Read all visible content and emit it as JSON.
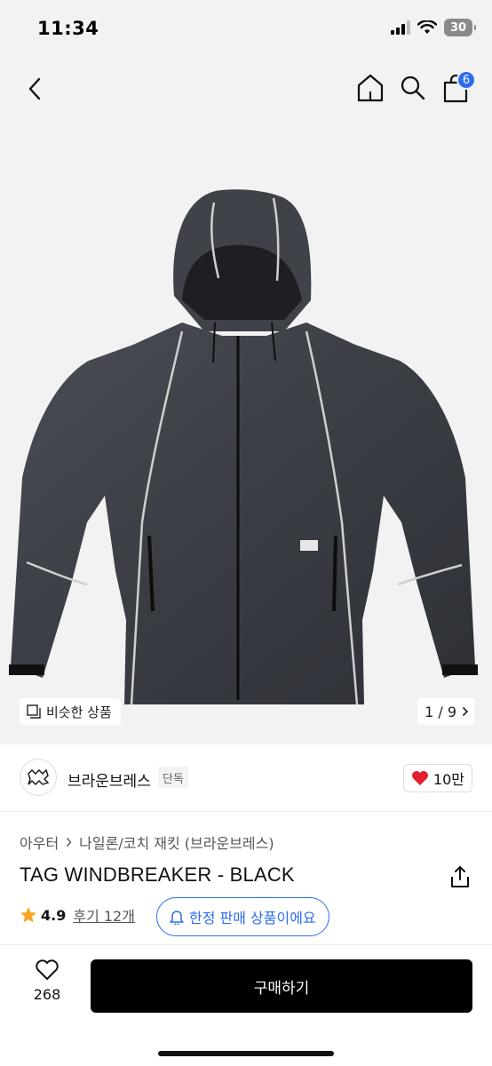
{
  "status_bar": {
    "time": "11:34",
    "battery": "30"
  },
  "top_nav": {
    "cart_count": "6"
  },
  "gallery": {
    "similar_label": "비슷한 상품",
    "page_indicator": "1 / 9"
  },
  "brand": {
    "name": "브라운브레스",
    "tag": "단독",
    "likes": "10만"
  },
  "product": {
    "breadcrumb": [
      "아우터",
      "나일론/코치 재킷 (브라운브레스)"
    ],
    "title": "TAG WINDBREAKER - BLACK",
    "rating": "4.9",
    "reviews": "후기 12개",
    "limited_label": "한정 판매 상품이에요"
  },
  "bottom_bar": {
    "like_count": "268",
    "buy_label": "구매하기"
  },
  "colors": {
    "accent": "#2d6cf0",
    "heart": "#e4202e",
    "star": "#f5a623",
    "buy_button": "#000000"
  },
  "icons": [
    "back-icon",
    "home-icon",
    "search-icon",
    "cart-icon",
    "similar-items-icon",
    "chevron-right-icon",
    "heart-icon",
    "share-icon",
    "star-icon",
    "bell-icon",
    "heart-outline-icon"
  ]
}
